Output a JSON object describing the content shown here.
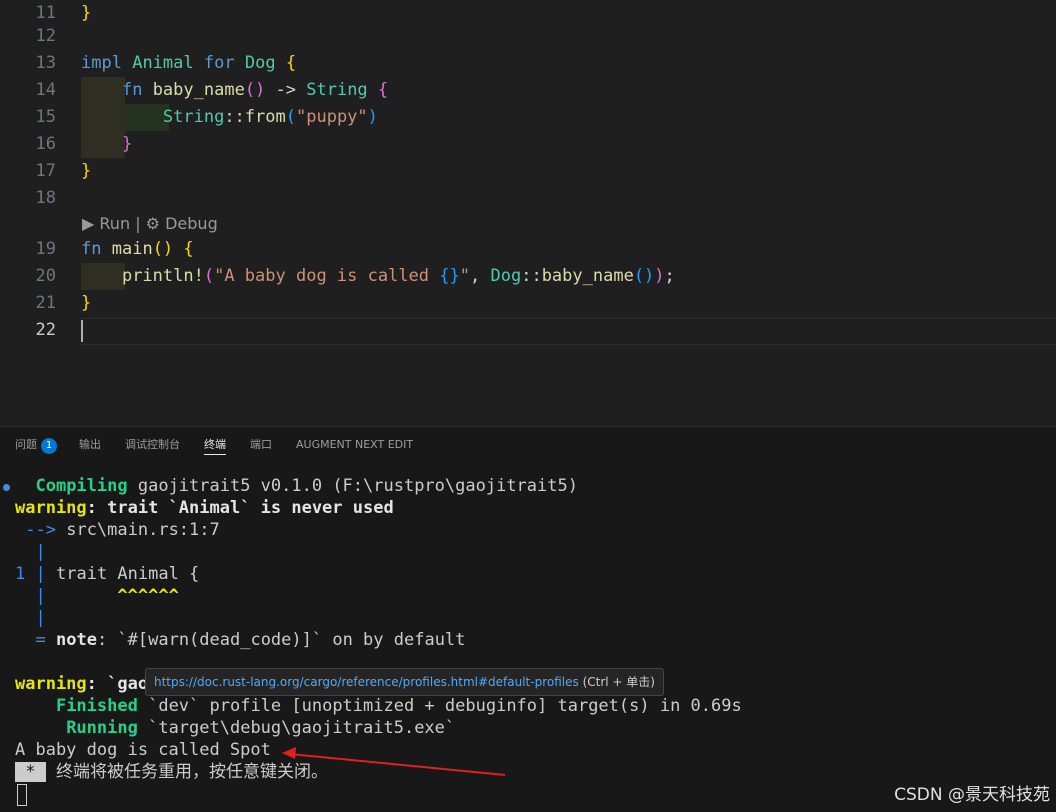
{
  "editor": {
    "lines": [
      {
        "num": "11",
        "code": "}"
      },
      {
        "num": "12",
        "code": ""
      },
      {
        "num": "13",
        "code": "impl Animal for Dog {"
      },
      {
        "num": "14",
        "code": "    fn baby_name() -> String {"
      },
      {
        "num": "15",
        "code": "        String::from(\"puppy\")"
      },
      {
        "num": "16",
        "code": "    }"
      },
      {
        "num": "17",
        "code": "}"
      },
      {
        "num": "18",
        "code": ""
      },
      {
        "num": "19",
        "code": "fn main() {"
      },
      {
        "num": "20",
        "code": "    println!(\"A baby dog is called {}\", Dog::baby_name());"
      },
      {
        "num": "21",
        "code": "}"
      },
      {
        "num": "22",
        "code": ""
      }
    ],
    "codelens": {
      "run": "Run",
      "separator": "|",
      "debug": "Debug"
    }
  },
  "panel": {
    "tabs": [
      {
        "label": "问题",
        "badge": "1"
      },
      {
        "label": "输出"
      },
      {
        "label": "调试控制台"
      },
      {
        "label": "终端"
      },
      {
        "label": "端口"
      },
      {
        "label": "AUGMENT NEXT EDIT"
      }
    ],
    "active_tab": "终端"
  },
  "terminal": {
    "compiling_kw": "Compiling",
    "compiling_rest": "gaojitrait5 v0.1.0 (F:\\rustpro\\gaojitrait5)",
    "warning_kw": "warning",
    "warning1_msg": ": trait `Animal` is never used",
    "arrow": "-->",
    "location": "src\\main.rs:1:7",
    "pipe": "|",
    "line_no": "1",
    "source_line": "trait Animal {",
    "carets": "^^^^^^",
    "note_eq": "=",
    "note_kw": "note",
    "note_msg": ": `#[warn(dead_code)]` on by default",
    "warning2_prefix": ": `gao",
    "finished_kw": "Finished",
    "finished_rest": "`dev` profile [unoptimized + debuginfo] target(s) in 0.69s",
    "running_kw": "Running",
    "running_rest": "`target\\debug\\gaojitrait5.exe`",
    "output": "A baby dog is called Spot",
    "star": " * ",
    "reuse_msg": "终端将被任务重用，按任意键关闭。"
  },
  "tooltip": {
    "url": "https://doc.rust-lang.org/cargo/reference/profiles.html#default-profiles",
    "hint": "(Ctrl + 单击)"
  },
  "watermark": "CSDN @景天科技苑",
  "colors": {
    "background": "#1f1f1f",
    "panel": "#181818",
    "keyword": "#569cd6",
    "type": "#4ec9b0",
    "function": "#dcdcaa",
    "string": "#ce9178",
    "terminal_green": "#23d18b",
    "terminal_yellow": "#e5e510",
    "terminal_blue": "#3b8eea",
    "annotation_arrow": "#e02020"
  }
}
